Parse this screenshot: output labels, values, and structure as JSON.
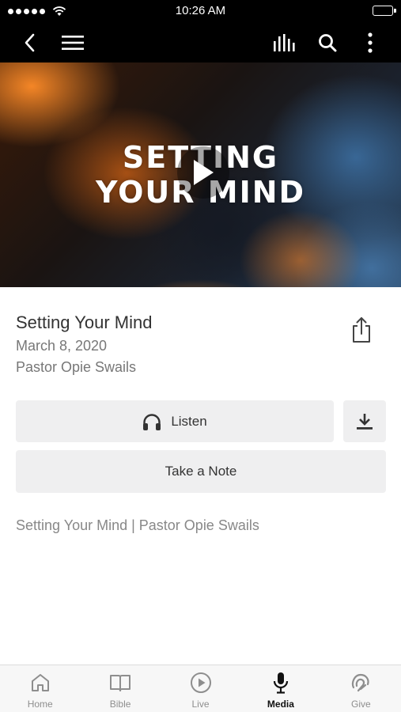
{
  "status_bar": {
    "time": "10:26 AM"
  },
  "nav": {
    "back_icon": "chevron-left-icon",
    "menu_icon": "hamburger-icon",
    "audio_icon": "equalizer-icon",
    "search_icon": "search-icon",
    "more_icon": "vertical-dots-icon"
  },
  "hero": {
    "title_line1": "SETTING",
    "title_line2": "YOUR MIND",
    "play_icon": "play-icon"
  },
  "sermon": {
    "title": "Setting Your Mind",
    "date": "March 8, 2020",
    "speaker": "Pastor Opie Swails",
    "description": "Setting Your Mind | Pastor Opie Swails"
  },
  "actions": {
    "listen_label": "Listen",
    "listen_icon": "headphones-icon",
    "download_icon": "download-icon",
    "note_label": "Take a Note",
    "share_icon": "share-icon"
  },
  "tabs": [
    {
      "label": "Home",
      "icon": "home-icon",
      "active": false
    },
    {
      "label": "Bible",
      "icon": "book-icon",
      "active": false
    },
    {
      "label": "Live",
      "icon": "play-circle-icon",
      "active": false
    },
    {
      "label": "Media",
      "icon": "microphone-icon",
      "active": true
    },
    {
      "label": "Give",
      "icon": "give-icon",
      "active": false
    }
  ],
  "colors": {
    "bar_bg": "#000000",
    "button_bg": "#efeff0",
    "active_tab": "#111111",
    "inactive_tab": "#8e8e8e"
  }
}
